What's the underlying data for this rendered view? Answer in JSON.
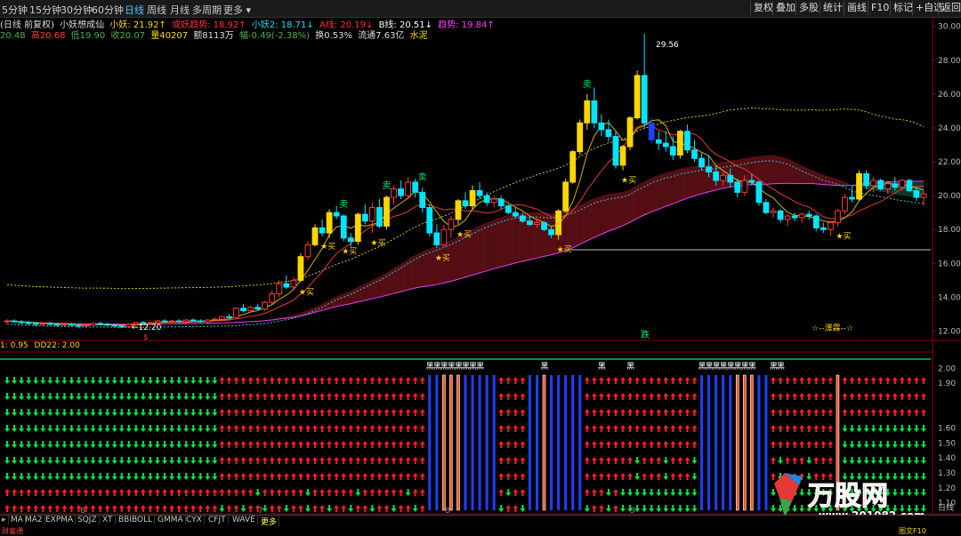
{
  "toolbar": {
    "timeframes": [
      {
        "label": "5分钟",
        "active": false
      },
      {
        "label": "15分钟",
        "active": false
      },
      {
        "label": "30分钟",
        "active": false
      },
      {
        "label": "60分钟",
        "active": false
      },
      {
        "label": "日线",
        "active": true
      },
      {
        "label": "周线",
        "active": false
      },
      {
        "label": "月线",
        "active": false
      },
      {
        "label": "多周期",
        "active": false
      },
      {
        "label": "更多 ▾",
        "active": false
      }
    ],
    "buttons": [
      "复权",
      "叠加",
      "多股",
      "统计",
      "画线",
      "F10",
      "标记",
      "+自选",
      "返回"
    ]
  },
  "legend_main": {
    "title": "(日线 前复权)",
    "indicator": "小妖想成仙",
    "items": [
      {
        "text": "小妖: 21.92↑",
        "color": "#ffd700"
      },
      {
        "text": "或妖趋势: 18.92↑",
        "color": "#ff3030"
      },
      {
        "text": "小妖2: 18.71↓",
        "color": "#00e5ff"
      },
      {
        "text": "A线: 20.19↓",
        "color": "#ff3030"
      },
      {
        "text": "B线: 20.51↓",
        "color": "#ffffff"
      },
      {
        "text": "趋势: 19.84↑",
        "color": "#ff40ff"
      }
    ]
  },
  "legend_quote": [
    {
      "text": "20.48",
      "color": "#4caf50"
    },
    {
      "text": "高20.68",
      "color": "#ff4040"
    },
    {
      "text": "低19.90",
      "color": "#4caf50"
    },
    {
      "text": "收20.07",
      "color": "#4caf50"
    },
    {
      "text": "量40207",
      "color": "#ffd700"
    },
    {
      "text": "额8113万",
      "color": "#dddddd"
    },
    {
      "text": "幅-0.49(-2.38%)",
      "color": "#4caf50"
    },
    {
      "text": "换0.53%",
      "color": "#dddddd"
    },
    {
      "text": "流通7.63亿",
      "color": "#dddddd"
    },
    {
      "text": "水泥",
      "color": "#ffd700"
    }
  ],
  "price_axis": [
    "30.00",
    "28.00",
    "26.00",
    "24.00",
    "22.00",
    "20.00",
    "18.00",
    "16.00",
    "14.00",
    "12.00"
  ],
  "annotations": {
    "high_label": "29.56",
    "low_label": "←12.20",
    "buy": "买",
    "sell": "卖",
    "fall": "跌",
    "s_mark": "$",
    "star_text": "☆--澤霖--☆",
    "black": "黑"
  },
  "indicator_legend": {
    "items": [
      {
        "text": "1: 0.95",
        "color": "#ffd700"
      },
      {
        "text": "DD22: 2.00",
        "color": "#ffd700"
      }
    ],
    "axis": [
      "2.00",
      "1.90",
      "1.60",
      "1.50",
      "1.40",
      "1.30",
      "1.20",
      "1.10"
    ],
    "axis_tag": "日线"
  },
  "bottom_tabs": [
    "MA",
    "MA2",
    "EXPMA",
    "SQJZ",
    "XT",
    "BBIBOLL",
    "GMMA",
    "CYX",
    "CFJT",
    "WAVE",
    "更多"
  ],
  "x_labels": [
    "6",
    "7",
    "8",
    "9"
  ],
  "status": {
    "left": "财富通",
    "right": "图文F10"
  },
  "watermark": {
    "brand": "万股网",
    "url": "www.201082.com"
  },
  "chart_data": {
    "type": "candlestick",
    "ylim": [
      11.5,
      30.3
    ],
    "candles": [
      [
        12.55,
        12.7,
        12.45,
        12.6
      ],
      [
        12.6,
        12.7,
        12.5,
        12.55
      ],
      [
        12.55,
        12.65,
        12.4,
        12.5
      ],
      [
        12.5,
        12.6,
        12.35,
        12.45
      ],
      [
        12.45,
        12.55,
        12.3,
        12.4
      ],
      [
        12.4,
        12.5,
        12.3,
        12.45
      ],
      [
        12.45,
        12.55,
        12.35,
        12.4
      ],
      [
        12.4,
        12.5,
        12.3,
        12.35
      ],
      [
        12.35,
        12.45,
        12.25,
        12.4
      ],
      [
        12.4,
        12.5,
        12.3,
        12.35
      ],
      [
        12.35,
        12.45,
        12.2,
        12.3
      ],
      [
        12.3,
        12.4,
        12.2,
        12.35
      ],
      [
        12.35,
        12.5,
        12.3,
        12.45
      ],
      [
        12.45,
        12.55,
        12.35,
        12.4
      ],
      [
        12.4,
        12.5,
        12.3,
        12.35
      ],
      [
        12.35,
        12.45,
        12.25,
        12.3
      ],
      [
        12.3,
        12.4,
        12.2,
        12.25
      ],
      [
        12.25,
        12.45,
        12.2,
        12.4
      ],
      [
        12.4,
        12.55,
        12.35,
        12.5
      ],
      [
        12.5,
        12.6,
        12.4,
        12.45
      ],
      [
        12.45,
        12.55,
        12.35,
        12.5
      ],
      [
        12.5,
        12.65,
        12.45,
        12.6
      ],
      [
        12.6,
        12.7,
        12.5,
        12.55
      ],
      [
        12.55,
        12.65,
        12.45,
        12.6
      ],
      [
        12.6,
        12.7,
        12.5,
        12.55
      ],
      [
        12.55,
        12.7,
        12.5,
        12.65
      ],
      [
        12.65,
        12.75,
        12.55,
        12.6
      ],
      [
        12.6,
        12.7,
        12.5,
        12.55
      ],
      [
        12.55,
        12.7,
        12.5,
        12.65
      ],
      [
        12.65,
        12.8,
        12.6,
        12.7
      ],
      [
        12.7,
        12.9,
        12.65,
        12.85
      ],
      [
        12.85,
        13.0,
        12.75,
        12.8
      ],
      [
        12.8,
        13.4,
        12.75,
        13.35
      ],
      [
        13.35,
        13.6,
        13.1,
        13.2
      ],
      [
        13.2,
        13.5,
        13.1,
        13.4
      ],
      [
        13.4,
        13.6,
        13.2,
        13.3
      ],
      [
        13.3,
        13.8,
        13.2,
        13.7
      ],
      [
        13.7,
        14.4,
        13.6,
        14.2
      ],
      [
        14.2,
        15.0,
        14.0,
        14.8
      ],
      [
        14.8,
        15.3,
        14.5,
        14.6
      ],
      [
        14.6,
        15.2,
        14.4,
        15.0
      ],
      [
        15.0,
        16.6,
        14.9,
        16.4
      ],
      [
        16.4,
        17.3,
        16.2,
        17.1
      ],
      [
        17.1,
        18.3,
        17.0,
        18.1
      ],
      [
        18.1,
        18.6,
        17.6,
        17.8
      ],
      [
        17.8,
        19.2,
        17.5,
        19.0
      ],
      [
        19.0,
        19.4,
        18.6,
        18.8
      ],
      [
        18.8,
        18.9,
        17.3,
        17.5
      ],
      [
        17.5,
        17.8,
        17.0,
        17.3
      ],
      [
        17.3,
        19.0,
        17.1,
        18.9
      ],
      [
        18.9,
        19.5,
        18.3,
        18.5
      ],
      [
        18.5,
        19.6,
        17.8,
        19.3
      ],
      [
        19.3,
        19.8,
        18.1,
        18.2
      ],
      [
        18.2,
        20.0,
        18.0,
        19.9
      ],
      [
        19.9,
        20.6,
        19.5,
        20.4
      ],
      [
        20.4,
        20.9,
        19.8,
        20.0
      ],
      [
        20.0,
        21.1,
        19.8,
        20.8
      ],
      [
        20.8,
        21.0,
        19.9,
        20.2
      ],
      [
        20.2,
        20.5,
        19.0,
        19.3
      ],
      [
        19.3,
        19.5,
        17.6,
        17.8
      ],
      [
        17.8,
        18.3,
        16.9,
        17.1
      ],
      [
        17.1,
        18.3,
        17.0,
        18.0
      ],
      [
        18.0,
        18.8,
        17.5,
        18.6
      ],
      [
        18.6,
        19.8,
        18.3,
        19.7
      ],
      [
        19.7,
        20.2,
        19.2,
        19.4
      ],
      [
        19.4,
        20.6,
        19.2,
        20.3
      ],
      [
        20.3,
        20.8,
        19.8,
        20.0
      ],
      [
        20.0,
        20.2,
        19.4,
        19.6
      ],
      [
        19.6,
        20.0,
        19.3,
        19.8
      ],
      [
        19.8,
        20.0,
        19.2,
        19.4
      ],
      [
        19.4,
        19.5,
        18.9,
        19.0
      ],
      [
        19.0,
        19.3,
        18.7,
        18.8
      ],
      [
        18.8,
        19.0,
        18.4,
        18.5
      ],
      [
        18.5,
        18.8,
        18.2,
        18.3
      ],
      [
        18.3,
        18.6,
        18.1,
        18.4
      ],
      [
        18.4,
        18.5,
        17.9,
        18.0
      ],
      [
        18.0,
        18.2,
        17.5,
        17.7
      ],
      [
        17.7,
        19.2,
        17.4,
        19.1
      ],
      [
        19.1,
        21.0,
        19.0,
        20.8
      ],
      [
        20.8,
        22.7,
        20.7,
        22.6
      ],
      [
        22.6,
        24.5,
        22.4,
        24.3
      ],
      [
        24.3,
        26.0,
        23.9,
        25.6
      ],
      [
        25.6,
        26.4,
        24.0,
        24.3
      ],
      [
        24.3,
        24.8,
        23.5,
        23.9
      ],
      [
        23.9,
        24.5,
        23.2,
        23.5
      ],
      [
        23.5,
        23.8,
        21.6,
        21.8
      ],
      [
        21.8,
        23.0,
        21.5,
        22.9
      ],
      [
        22.9,
        24.7,
        22.7,
        24.6
      ],
      [
        24.6,
        27.4,
        24.5,
        27.1
      ],
      [
        27.1,
        29.56,
        24.0,
        24.3
      ],
      [
        24.3,
        24.6,
        23.1,
        23.3
      ],
      [
        23.3,
        23.8,
        22.7,
        23.1
      ],
      [
        23.1,
        23.8,
        22.6,
        22.9
      ],
      [
        22.9,
        23.5,
        22.1,
        22.4
      ],
      [
        22.4,
        23.9,
        22.2,
        23.8
      ],
      [
        23.8,
        24.2,
        22.5,
        22.7
      ],
      [
        22.7,
        23.3,
        22.0,
        22.2
      ],
      [
        22.2,
        22.5,
        21.5,
        21.7
      ],
      [
        21.7,
        22.4,
        21.1,
        21.4
      ],
      [
        21.4,
        21.8,
        20.6,
        20.9
      ],
      [
        20.9,
        21.4,
        20.6,
        21.2
      ],
      [
        21.2,
        21.6,
        20.5,
        20.8
      ],
      [
        20.8,
        21.0,
        19.9,
        20.2
      ],
      [
        20.2,
        21.2,
        20.0,
        20.9
      ],
      [
        20.9,
        21.3,
        20.6,
        20.8
      ],
      [
        20.8,
        20.9,
        19.4,
        19.6
      ],
      [
        19.6,
        19.8,
        18.9,
        19.0
      ],
      [
        19.0,
        19.3,
        18.7,
        19.1
      ],
      [
        19.1,
        19.2,
        18.4,
        18.6
      ],
      [
        18.6,
        18.9,
        18.2,
        18.8
      ],
      [
        18.8,
        19.0,
        18.5,
        18.7
      ],
      [
        18.7,
        19.0,
        18.4,
        18.9
      ],
      [
        18.9,
        19.1,
        18.6,
        18.8
      ],
      [
        18.8,
        18.9,
        17.9,
        18.1
      ],
      [
        18.1,
        18.4,
        17.8,
        18.0
      ],
      [
        18.0,
        18.5,
        17.6,
        18.4
      ],
      [
        18.4,
        19.2,
        18.2,
        19.1
      ],
      [
        19.1,
        20.1,
        18.9,
        19.9
      ],
      [
        19.9,
        20.6,
        19.6,
        19.8
      ],
      [
        19.8,
        21.5,
        19.7,
        21.3
      ],
      [
        21.3,
        21.5,
        20.4,
        20.6
      ],
      [
        20.6,
        21.1,
        20.2,
        20.9
      ],
      [
        20.9,
        21.0,
        20.3,
        20.4
      ],
      [
        20.4,
        20.9,
        20.1,
        20.7
      ],
      [
        20.7,
        21.1,
        20.3,
        20.5
      ],
      [
        20.5,
        21.0,
        20.3,
        20.9
      ],
      [
        20.9,
        21.0,
        20.2,
        20.3
      ],
      [
        20.3,
        20.5,
        19.7,
        19.9
      ],
      [
        19.9,
        20.3,
        19.4,
        20.1
      ]
    ]
  }
}
